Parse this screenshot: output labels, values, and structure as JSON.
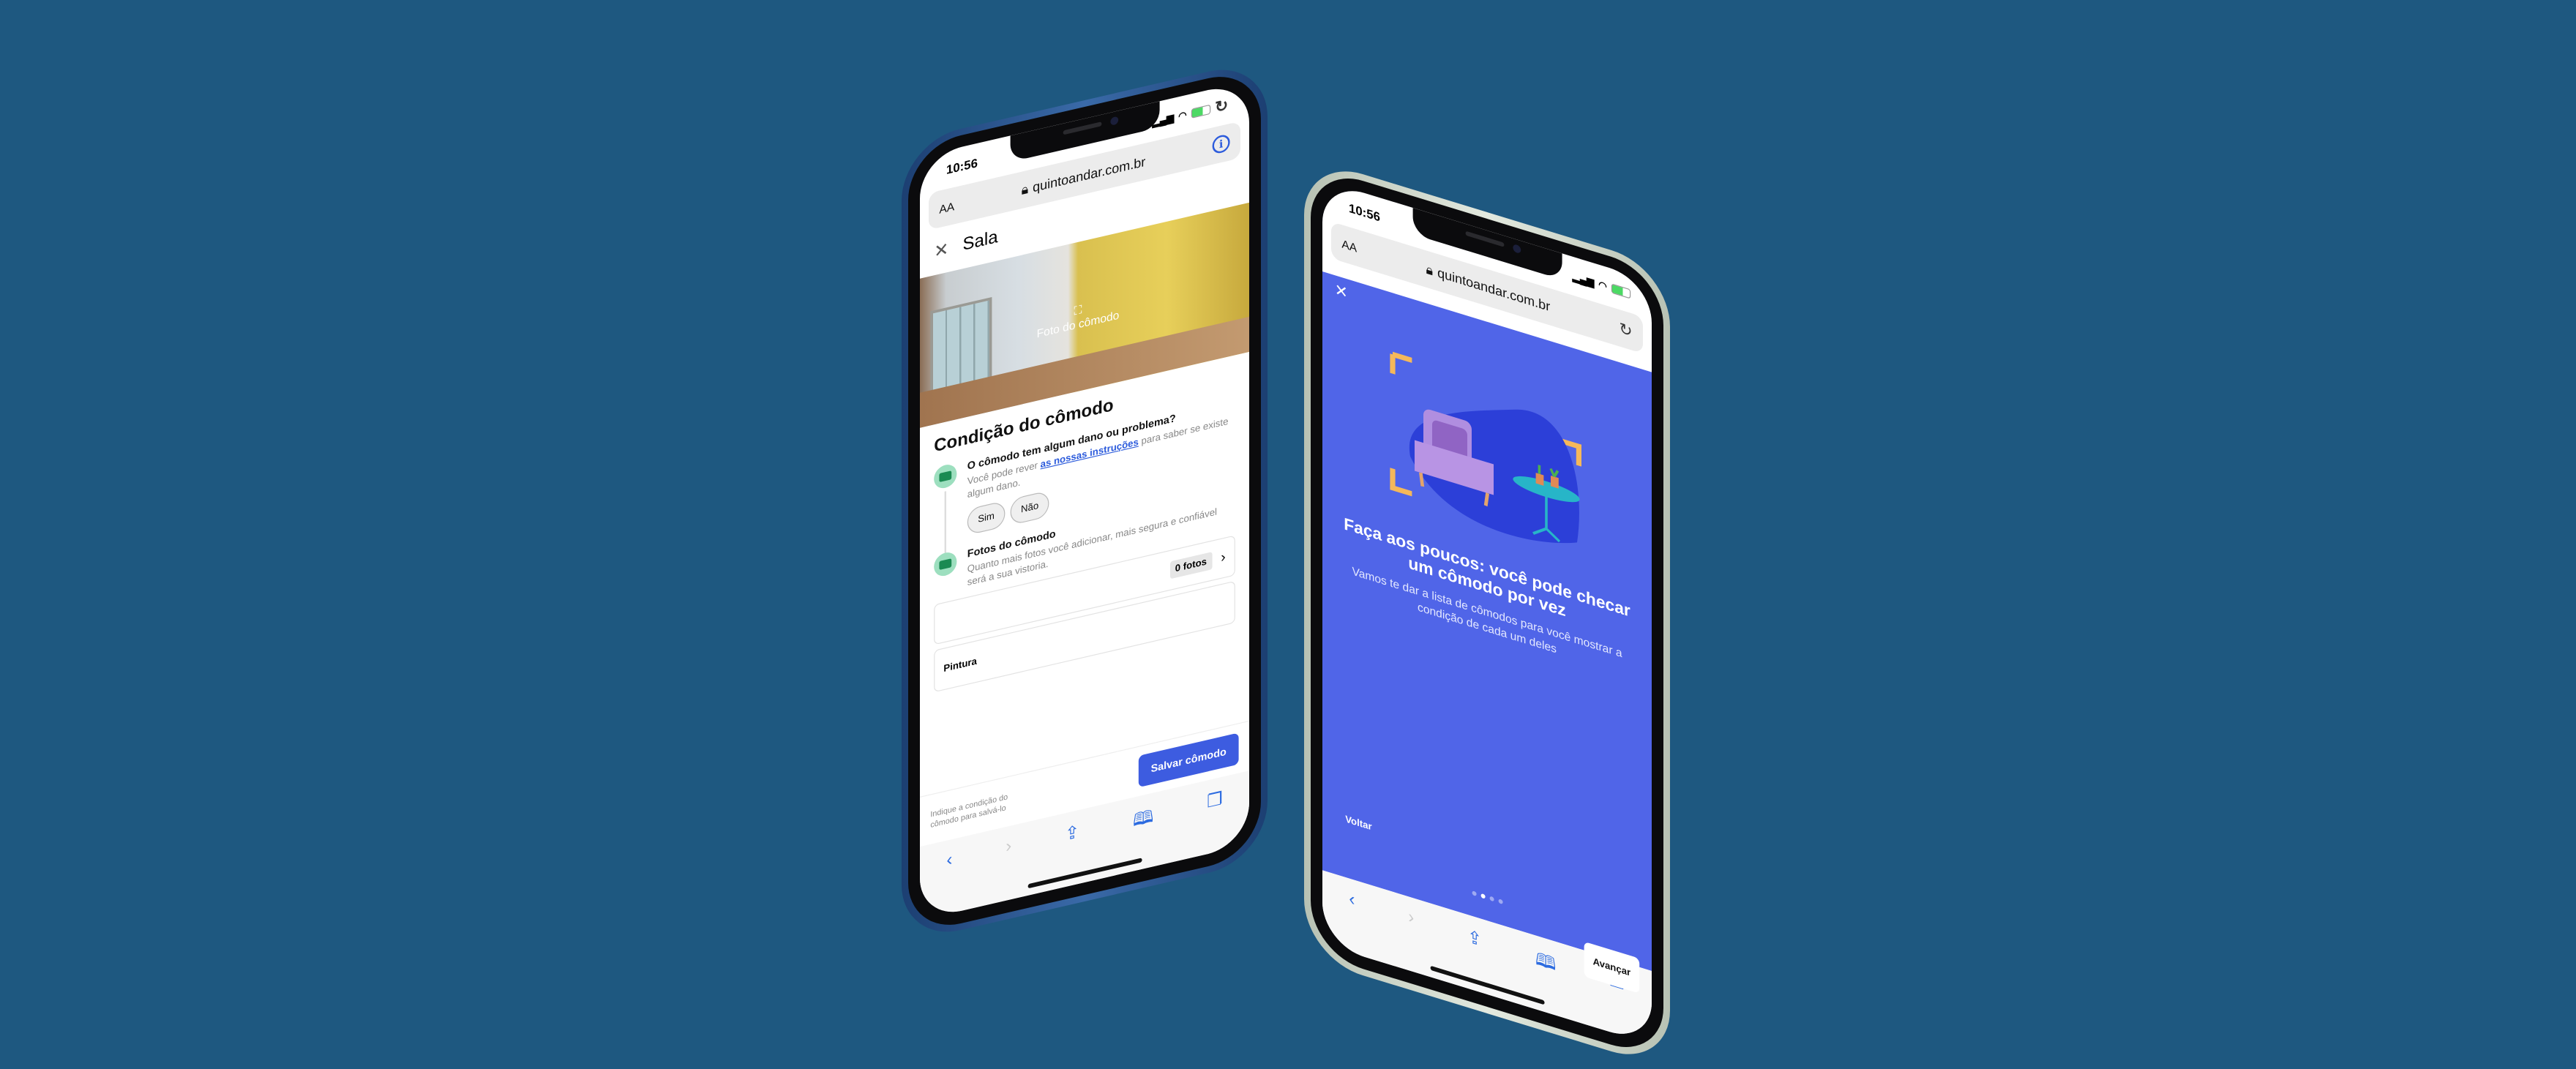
{
  "status": {
    "time": "10:56"
  },
  "browser": {
    "text_size": "AA",
    "url": "quintoandar.com.br"
  },
  "left_screen": {
    "title": "Sala",
    "photo_label": "Foto do cômodo",
    "section_title": "Condição do cômodo",
    "question": "O cômodo tem algum dano ou problema?",
    "question_desc_before": "Você pode rever ",
    "question_link": "as nossas instruções",
    "question_desc_after": " para saber se existe algum dano.",
    "yes": "Sim",
    "no": "Não",
    "photos_title": "Fotos do cômodo",
    "photos_desc": "Quanto mais fotos você adicionar, mais segura e confiável será a sua vistoria.",
    "photos_count": "0 fotos",
    "item_painting": "Pintura",
    "save_hint": "Indique a condição do cômodo para salvá-lo",
    "save_button": "Salvar cômodo"
  },
  "right_screen": {
    "title": "Faça aos poucos: você pode checar um cômodo por vez",
    "body": "Vamos te dar a lista de cômodos para você mostrar a condição de cada um deles",
    "back": "Voltar",
    "next": "Avançar",
    "page_total": 4,
    "page_current": 2
  },
  "colors": {
    "background": "#1e5880",
    "primary": "#3d5ce0",
    "onboarding": "#5065e8",
    "success": "#9ddfbf"
  }
}
